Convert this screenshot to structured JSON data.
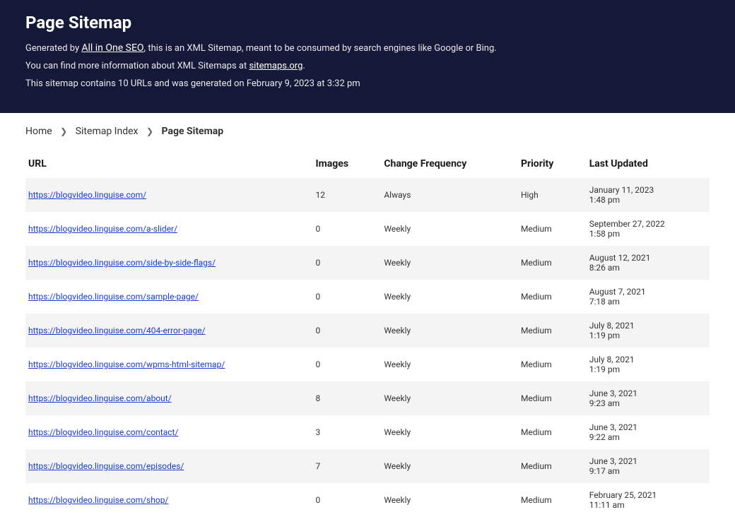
{
  "header": {
    "title": "Page Sitemap",
    "generated_prefix": "Generated by ",
    "generator_link": "All in One SEO",
    "generated_suffix": ", this is an XML Sitemap, meant to be consumed by search engines like Google or Bing.",
    "more_info_prefix": "You can find more information about XML Sitemaps at ",
    "more_info_link": "sitemaps.org",
    "more_info_suffix": ".",
    "stats": "This sitemap contains 10 URLs and was generated on February 9, 2023 at 3:32 pm"
  },
  "breadcrumb": {
    "home": "Home",
    "index": "Sitemap Index",
    "current": "Page Sitemap",
    "sep": "❯"
  },
  "columns": {
    "url": "URL",
    "images": "Images",
    "frequency": "Change Frequency",
    "priority": "Priority",
    "updated": "Last Updated"
  },
  "rows": [
    {
      "url": "https://blogvideo.linguise.com/",
      "images": "12",
      "frequency": "Always",
      "priority": "High",
      "date": "January 11, 2023",
      "time": "1:48 pm"
    },
    {
      "url": "https://blogvideo.linguise.com/a-slider/",
      "images": "0",
      "frequency": "Weekly",
      "priority": "Medium",
      "date": "September 27, 2022",
      "time": "1:58 pm"
    },
    {
      "url": "https://blogvideo.linguise.com/side-by-side-flags/",
      "images": "0",
      "frequency": "Weekly",
      "priority": "Medium",
      "date": "August 12, 2021",
      "time": "8:26 am"
    },
    {
      "url": "https://blogvideo.linguise.com/sample-page/",
      "images": "0",
      "frequency": "Weekly",
      "priority": "Medium",
      "date": "August 7, 2021",
      "time": "7:18 am"
    },
    {
      "url": "https://blogvideo.linguise.com/404-error-page/",
      "images": "0",
      "frequency": "Weekly",
      "priority": "Medium",
      "date": "July 8, 2021",
      "time": "1:19 pm"
    },
    {
      "url": "https://blogvideo.linguise.com/wpms-html-sitemap/",
      "images": "0",
      "frequency": "Weekly",
      "priority": "Medium",
      "date": "July 8, 2021",
      "time": "1:19 pm"
    },
    {
      "url": "https://blogvideo.linguise.com/about/",
      "images": "8",
      "frequency": "Weekly",
      "priority": "Medium",
      "date": "June 3, 2021",
      "time": "9:23 am"
    },
    {
      "url": "https://blogvideo.linguise.com/contact/",
      "images": "3",
      "frequency": "Weekly",
      "priority": "Medium",
      "date": "June 3, 2021",
      "time": "9:22 am"
    },
    {
      "url": "https://blogvideo.linguise.com/episodes/",
      "images": "7",
      "frequency": "Weekly",
      "priority": "Medium",
      "date": "June 3, 2021",
      "time": "9:17 am"
    },
    {
      "url": "https://blogvideo.linguise.com/shop/",
      "images": "0",
      "frequency": "Weekly",
      "priority": "Medium",
      "date": "February 25, 2021",
      "time": "11:11 am"
    }
  ]
}
